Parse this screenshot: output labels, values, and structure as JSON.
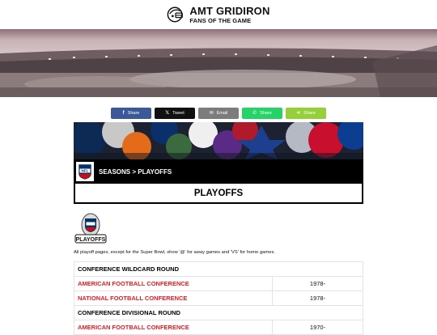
{
  "site": {
    "title": "AMT GRIDIRON",
    "tagline": "FANS OF THE GAME"
  },
  "share": [
    {
      "name": "facebook",
      "icon": "f",
      "label": "Share",
      "color": "#3b5998"
    },
    {
      "name": "twitter",
      "icon": "𝕏",
      "label": "Tweet",
      "color": "#111111"
    },
    {
      "name": "email",
      "icon": "✉",
      "label": "Email",
      "color": "#7c7c7c"
    },
    {
      "name": "whatsapp",
      "icon": "✆",
      "label": "Share",
      "color": "#25d366"
    },
    {
      "name": "sharethis",
      "icon": "⋖",
      "label": "Share",
      "color": "#95d03a"
    }
  ],
  "breadcrumb": "SEASONS > PLAYOFFS",
  "page_title": "PLAYOFFS",
  "playoffs_logo_text": "PLAYOFFS",
  "intro": "All playoff pages, except for the Super Bowl, show '@' for away games and 'VS' for home games.",
  "table": {
    "rows": [
      {
        "type": "section",
        "label": "CONFERENCE WILDCARD ROUND",
        "years": ""
      },
      {
        "type": "link",
        "label": "AMERICAN FOOTBALL CONFERENCE",
        "years": "1978-"
      },
      {
        "type": "link",
        "label": "NATIONAL FOOTBALL CONFERENCE",
        "years": "1978-"
      },
      {
        "type": "section",
        "label": "CONFERENCE DIVISIONAL ROUND",
        "years": ""
      },
      {
        "type": "link",
        "label": "AMERICAN FOOTBALL CONFERENCE",
        "years": "1970-"
      }
    ]
  },
  "colors": {
    "link": "#e31b23",
    "header_bar": "#000000"
  }
}
